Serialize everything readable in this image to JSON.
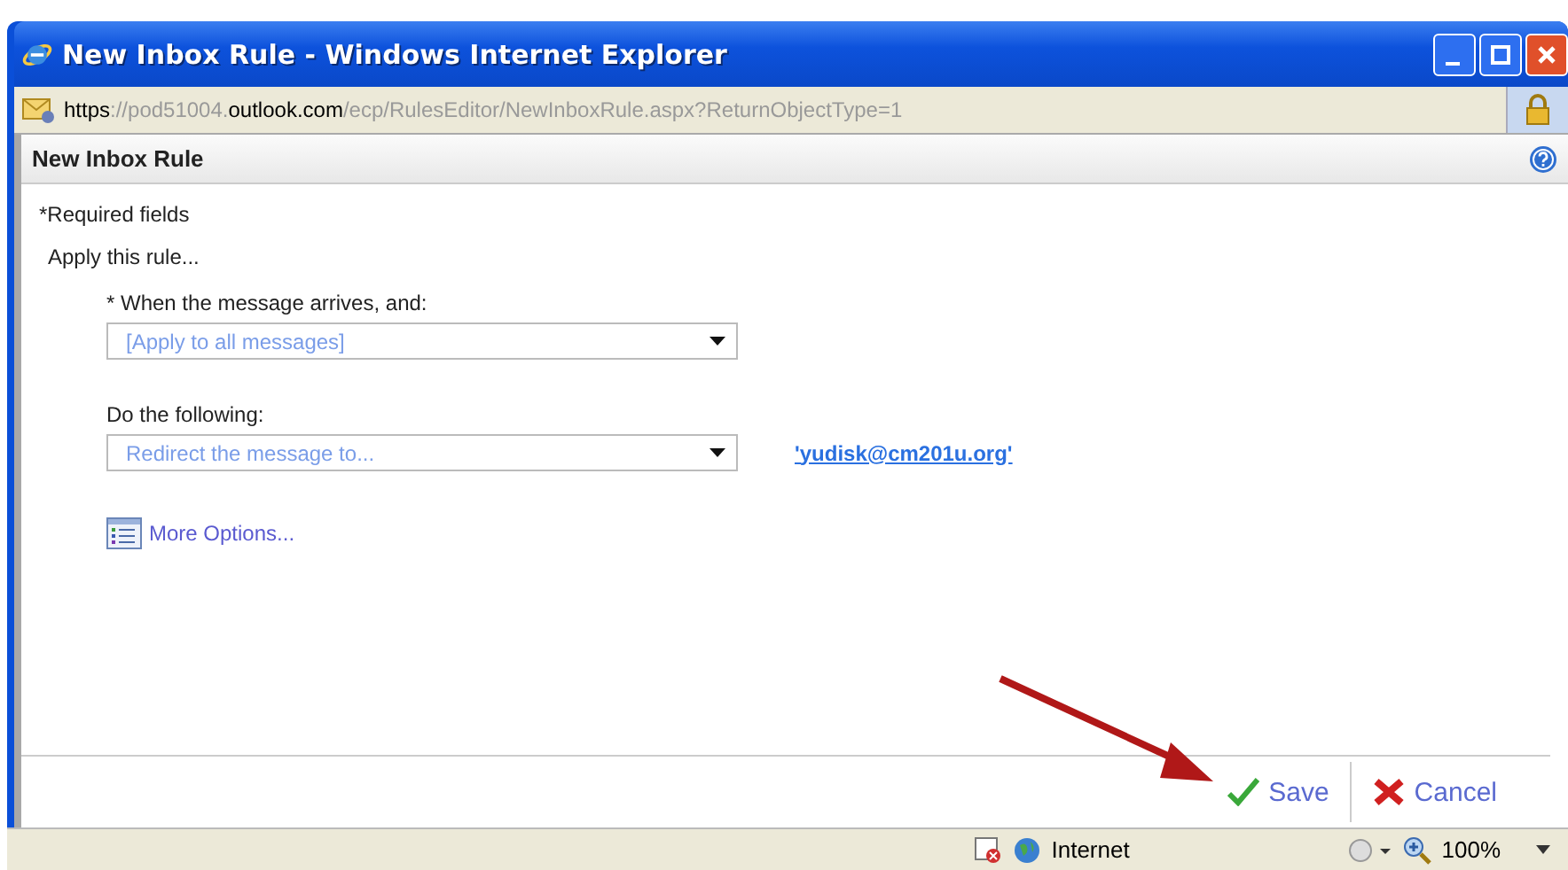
{
  "window": {
    "title": "New Inbox Rule - Windows Internet Explorer"
  },
  "address_bar": {
    "segments": [
      {
        "text": "https",
        "dim": false
      },
      {
        "text": "://pod51004.",
        "dim": true
      },
      {
        "text": "outlook.com",
        "dim": false
      },
      {
        "text": "/ecp/RulesEditor/NewInboxRule.aspx?ReturnObjectType=1",
        "dim": true
      }
    ]
  },
  "page_header": {
    "title": "New Inbox Rule"
  },
  "required_note": "*Required fields",
  "section_label": "Apply this rule...",
  "conditions": [
    {
      "label": "* When the message arrives, and:",
      "value": "[Apply to all messages]"
    },
    {
      "label": "Do the following:",
      "value": "Redirect the message to...",
      "link": "'yudisk@cm201u.org'"
    }
  ],
  "more_options": "More Options...",
  "buttons": [
    {
      "kind": "save",
      "label": "Save"
    },
    {
      "kind": "cancel",
      "label": "Cancel"
    }
  ],
  "status_bar": {
    "zone": "Internet",
    "zoom": "100%"
  }
}
